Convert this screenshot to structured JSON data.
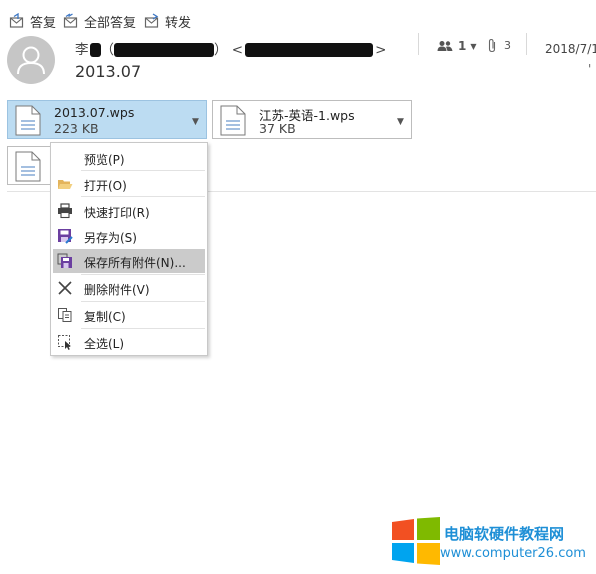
{
  "toolbar": {
    "reply": "答复",
    "reply_all": "全部答复",
    "forward": "转发"
  },
  "header": {
    "sender_prefix": "李",
    "sender_paren_open": "（",
    "sender_paren_close": "）",
    "sender_email_open": "<",
    "sender_email_close": ">",
    "subject": "2013.07",
    "participants_count": "1",
    "attachments_count": "3",
    "date": "2018/7/1"
  },
  "attachments": [
    {
      "name": "2013.07.wps",
      "size": "223 KB",
      "selected": true
    },
    {
      "name": "江苏-英语-1.wps",
      "size": "37 KB",
      "selected": false
    }
  ],
  "context_menu": {
    "items": [
      {
        "label": "预览(P)",
        "icon": "none"
      },
      {
        "label": "打开(O)",
        "icon": "folder-open-icon"
      },
      {
        "label": "快速打印(R)",
        "icon": "printer-icon"
      },
      {
        "label": "另存为(S)",
        "icon": "save-as-icon"
      },
      {
        "label": "保存所有附件(N)...",
        "icon": "save-all-icon",
        "highlighted": true
      },
      {
        "label": "删除附件(V)",
        "icon": "close-icon"
      },
      {
        "label": "复制(C)",
        "icon": "copy-icon"
      },
      {
        "label": "全选(L)",
        "icon": "select-all-icon"
      }
    ]
  },
  "watermark": {
    "title": "电脑软硬件教程网",
    "url": "www.computer26.com",
    "colors": [
      "#f25022",
      "#7fba00",
      "#00a4ef",
      "#ffb900"
    ]
  },
  "colors": {
    "selected_attachment": "#bcdcf2",
    "menu_highlight": "#cbcbcb",
    "watermark_text": "#1e8fd6"
  }
}
